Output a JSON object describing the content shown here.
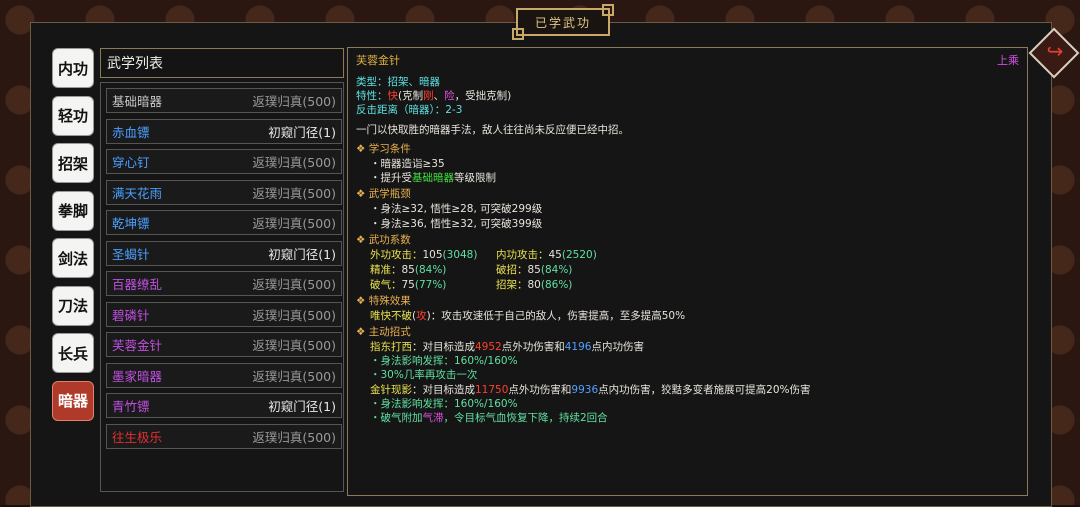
{
  "page_title": "已学武功",
  "back_icon": "return-arrow-icon",
  "tabs": [
    {
      "label": "内功",
      "active": false
    },
    {
      "label": "轻功",
      "active": false
    },
    {
      "label": "招架",
      "active": false
    },
    {
      "label": "拳脚",
      "active": false
    },
    {
      "label": "剑法",
      "active": false
    },
    {
      "label": "刀法",
      "active": false
    },
    {
      "label": "长兵",
      "active": false
    },
    {
      "label": "暗器",
      "active": true
    }
  ],
  "list": {
    "header": "武学列表",
    "items": [
      {
        "name": "基础暗器",
        "rank": "返璞归真(500)",
        "name_color": "#c8c8c8"
      },
      {
        "name": "赤血镖",
        "rank": "初窥门径(1)",
        "name_color": "#4aa0ff"
      },
      {
        "name": "穿心钉",
        "rank": "返璞归真(500)",
        "name_color": "#4aa0ff"
      },
      {
        "name": "满天花雨",
        "rank": "返璞归真(500)",
        "name_color": "#4aa0ff"
      },
      {
        "name": "乾坤镖",
        "rank": "返璞归真(500)",
        "name_color": "#4aa0ff"
      },
      {
        "name": "圣蝎针",
        "rank": "初窥门径(1)",
        "name_color": "#4aa0ff"
      },
      {
        "name": "百器缭乱",
        "rank": "返璞归真(500)",
        "name_color": "#c050e0"
      },
      {
        "name": "碧磷针",
        "rank": "返璞归真(500)",
        "name_color": "#c050e0"
      },
      {
        "name": "芙蓉金针",
        "rank": "返璞归真(500)",
        "name_color": "#c050e0"
      },
      {
        "name": "墨家暗器",
        "rank": "返璞归真(500)",
        "name_color": "#c050e0"
      },
      {
        "name": "青竹镖",
        "rank": "初窥门径(1)",
        "name_color": "#c050e0"
      },
      {
        "name": "往生极乐",
        "rank": "返璞归真(500)",
        "name_color": "#e03030"
      }
    ]
  },
  "detail": {
    "title": "芙蓉金针",
    "tier": "上乘",
    "type_label": "类型：",
    "type_value": "招架、暗器",
    "trait_label": "特性：",
    "trait_fast": "快",
    "trait_counter1": "(克制",
    "trait_gang": "刚",
    "trait_sep": "、",
    "trait_xian": "险",
    "trait_counter2": "，受拙克制)",
    "range_label": "反击距离（暗器）：",
    "range_value": "2-3",
    "desc": "一门以快取胜的暗器手法，敌人往往尚未反应便已经中招。",
    "learn_title": "学习条件",
    "learn_1": "・暗器造诣≥35",
    "learn_2a": "・提升受",
    "learn_2b": "基础暗器",
    "learn_2c": "等级限制",
    "bottleneck_title": "武学瓶颈",
    "bottleneck_1": "・身法≥32, 悟性≥28, 可突破299级",
    "bottleneck_2": "・身法≥36, 悟性≥32, 可突破399级",
    "coef_title": "武功系数",
    "stats": [
      {
        "label": "外功攻击：",
        "value": "105",
        "extra": "(3048)"
      },
      {
        "label": "内功攻击：",
        "value": "45",
        "extra": "(2520)"
      },
      {
        "label": "精准：",
        "value": "85",
        "extra": "(84%)"
      },
      {
        "label": "破招：",
        "value": "85",
        "extra": "(84%)"
      },
      {
        "label": "破气：",
        "value": "75",
        "extra": "(77%)"
      },
      {
        "label": "招架：",
        "value": "80",
        "extra": "(86%)"
      }
    ],
    "special_title": "特殊效果",
    "special_name": "唯快不破",
    "special_tag_open": "(",
    "special_tag": "攻",
    "special_tag_close": ")",
    "special_text": "：攻击攻速低于自己的敌人，伤害提高，至多提高50%",
    "moves_title": "主动招式",
    "move1_name": "指东打西",
    "move1_a": "：对目标造成",
    "move1_dmg1": "4952",
    "move1_b": "点外功伤害和",
    "move1_dmg2": "4196",
    "move1_c": "点内功伤害",
    "move1_sub1": "・身法影响发挥：160%/160%",
    "move1_sub2": "・30%几率再攻击一次",
    "move2_name": "金针现影",
    "move2_a": "：对目标造成",
    "move2_dmg1": "11750",
    "move2_b": "点外功伤害和",
    "move2_dmg2": "9936",
    "move2_c": "点内功伤害，狡黠多变者施展可提高20%伤害",
    "move2_sub1": "・身法影响发挥：160%/160%",
    "move2_sub2a": "・破气附加",
    "move2_sub2b": "气滞",
    "move2_sub2c": "，令目标气血恢复下降，持续2回合"
  }
}
